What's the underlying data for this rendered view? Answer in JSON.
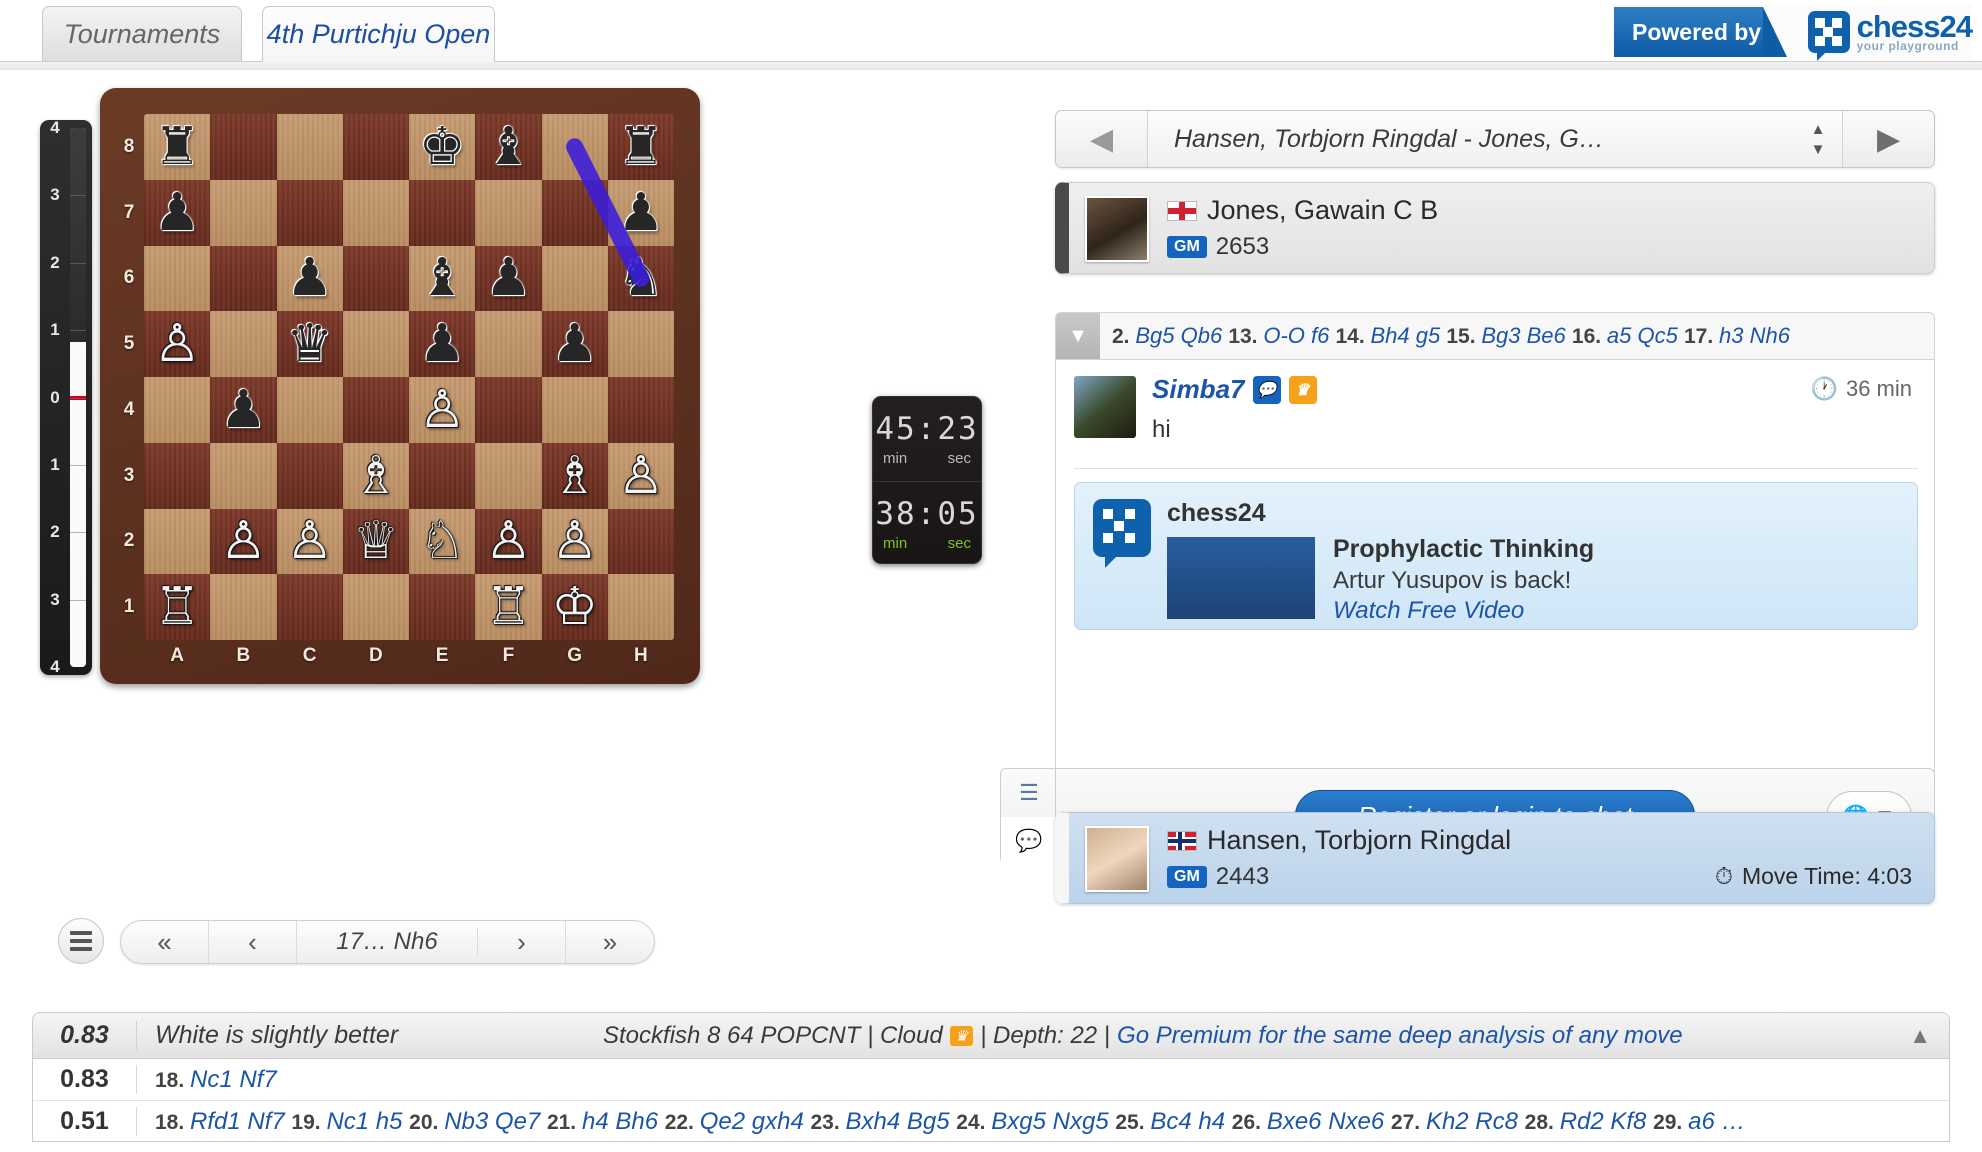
{
  "tabs": {
    "inactive": "Tournaments",
    "active": "4th Purtichju Open"
  },
  "powered": {
    "label": "Powered by",
    "brand": "chess24",
    "tagline": "your playground"
  },
  "eval_bar": {
    "ticks": [
      "4",
      "3",
      "2",
      "1",
      "0",
      "1",
      "2",
      "3",
      "4"
    ],
    "value": 0.83,
    "max": 4
  },
  "board": {
    "files": [
      "A",
      "B",
      "C",
      "D",
      "E",
      "F",
      "G",
      "H"
    ],
    "ranks": [
      "8",
      "7",
      "6",
      "5",
      "4",
      "3",
      "2",
      "1"
    ],
    "pieces": [
      {
        "sq": "a8",
        "color": "b",
        "type": "rook",
        "glyph": "♜"
      },
      {
        "sq": "e8",
        "color": "b",
        "type": "king",
        "glyph": "♚"
      },
      {
        "sq": "f8",
        "color": "b",
        "type": "bishop",
        "glyph": "♝"
      },
      {
        "sq": "h8",
        "color": "b",
        "type": "rook",
        "glyph": "♜"
      },
      {
        "sq": "a7",
        "color": "b",
        "type": "pawn",
        "glyph": "♟"
      },
      {
        "sq": "h7",
        "color": "b",
        "type": "pawn",
        "glyph": "♟"
      },
      {
        "sq": "c6",
        "color": "b",
        "type": "pawn",
        "glyph": "♟"
      },
      {
        "sq": "e6",
        "color": "b",
        "type": "bishop",
        "glyph": "♝"
      },
      {
        "sq": "f6",
        "color": "b",
        "type": "pawn",
        "glyph": "♟"
      },
      {
        "sq": "h6",
        "color": "b",
        "type": "knight",
        "glyph": "♞"
      },
      {
        "sq": "a5",
        "color": "w",
        "type": "pawn",
        "glyph": "♙"
      },
      {
        "sq": "c5",
        "color": "b",
        "type": "queen",
        "glyph": "♛"
      },
      {
        "sq": "e5",
        "color": "b",
        "type": "pawn",
        "glyph": "♟"
      },
      {
        "sq": "g5",
        "color": "b",
        "type": "pawn",
        "glyph": "♟"
      },
      {
        "sq": "b4",
        "color": "b",
        "type": "pawn",
        "glyph": "♟"
      },
      {
        "sq": "e4",
        "color": "w",
        "type": "pawn",
        "glyph": "♙"
      },
      {
        "sq": "d3",
        "color": "w",
        "type": "bishop",
        "glyph": "♗"
      },
      {
        "sq": "g3",
        "color": "w",
        "type": "bishop",
        "glyph": "♗"
      },
      {
        "sq": "h3",
        "color": "w",
        "type": "pawn",
        "glyph": "♙"
      },
      {
        "sq": "b2",
        "color": "w",
        "type": "pawn",
        "glyph": "♙"
      },
      {
        "sq": "c2",
        "color": "w",
        "type": "pawn",
        "glyph": "♙"
      },
      {
        "sq": "d2",
        "color": "w",
        "type": "queen",
        "glyph": "♕"
      },
      {
        "sq": "e2",
        "color": "w",
        "type": "knight",
        "glyph": "♘"
      },
      {
        "sq": "f2",
        "color": "w",
        "type": "pawn",
        "glyph": "♙"
      },
      {
        "sq": "g2",
        "color": "w",
        "type": "pawn",
        "glyph": "♙"
      },
      {
        "sq": "a1",
        "color": "w",
        "type": "rook",
        "glyph": "♖"
      },
      {
        "sq": "f1",
        "color": "w",
        "type": "rook",
        "glyph": "♖"
      },
      {
        "sq": "g1",
        "color": "w",
        "type": "king",
        "glyph": "♔"
      }
    ],
    "arrow": {
      "from": "g8",
      "to": "h6",
      "color": "#3b1ddb"
    }
  },
  "clocks": {
    "top": {
      "min": "45",
      "sec": "23",
      "min_label": "min",
      "sec_label": "sec",
      "active": false
    },
    "bottom": {
      "min": "38",
      "sec": "05",
      "min_label": "min",
      "sec_label": "sec",
      "active": true
    }
  },
  "board_nav": {
    "menu_icon": "hamburger-icon",
    "first": "«",
    "prev": "‹",
    "current_move": "17… Nh6",
    "next": "›",
    "last": "»"
  },
  "game_selector": {
    "prev_icon": "◀",
    "title": "Hansen, Torbjorn Ringdal - Jones, G…",
    "next_icon": "▶",
    "spinner_up": "▲",
    "spinner_down": "▼"
  },
  "players": {
    "black": {
      "name": "Jones, Gawain C B",
      "title": "GM",
      "rating": "2653",
      "country": "England"
    },
    "white": {
      "name": "Hansen, Torbjorn Ringdal",
      "title": "GM",
      "rating": "2443",
      "country": "Norway",
      "move_time": "Move Time: 4:03"
    }
  },
  "move_strip": {
    "collapse_icon": "▼",
    "tokens": [
      {
        "t": "2.",
        "k": "no"
      },
      {
        "t": "Bg5 Qb6",
        "k": "mv"
      },
      {
        "t": "13.",
        "k": "no"
      },
      {
        "t": "O-O f6",
        "k": "mv"
      },
      {
        "t": "14.",
        "k": "no"
      },
      {
        "t": "Bh4 g5",
        "k": "mv"
      },
      {
        "t": "15.",
        "k": "no"
      },
      {
        "t": "Bg3 Be6",
        "k": "mv"
      },
      {
        "t": "16.",
        "k": "no"
      },
      {
        "t": "a5 Qc5",
        "k": "mv"
      },
      {
        "t": "17.",
        "k": "no"
      },
      {
        "t": "h3 Nh6",
        "k": "mv"
      }
    ]
  },
  "chat": {
    "message": {
      "user": "Simba7",
      "text": "hi",
      "time": "36 min",
      "badges": [
        "chat-badge",
        "premium-crown-badge"
      ],
      "clock_icon": "clock-icon"
    },
    "ad": {
      "brand": "chess24",
      "title": "Prophylactic Thinking",
      "subtitle": "Artur Yusupov is back!",
      "link": "Watch Free Video"
    },
    "login_button": "Register or login to chat",
    "lang_icon": "globe-icon",
    "tabs": [
      "list-icon",
      "chat-bubbles-icon"
    ]
  },
  "analysis": {
    "header": {
      "score": "0.83",
      "verdict": "White is slightly better",
      "engine": "Stockfish 8 64 POPCNT | Cloud",
      "cloud_badge": "♛",
      "depth": "| Depth: 22 |",
      "premium_link": "Go Premium for the same deep analysis of any move",
      "collapse_icon": "▲"
    },
    "lines": [
      {
        "score": "0.83",
        "tokens": [
          {
            "t": "18.",
            "k": "no"
          },
          {
            "t": "Nc1 Nf7",
            "k": "mv"
          }
        ]
      },
      {
        "score": "0.51",
        "tokens": [
          {
            "t": "18.",
            "k": "no"
          },
          {
            "t": "Rfd1 Nf7",
            "k": "mv"
          },
          {
            "t": "19.",
            "k": "no"
          },
          {
            "t": "Nc1 h5",
            "k": "mv"
          },
          {
            "t": "20.",
            "k": "no"
          },
          {
            "t": "Nb3 Qe7",
            "k": "mv"
          },
          {
            "t": "21.",
            "k": "no"
          },
          {
            "t": "h4 Bh6",
            "k": "mv"
          },
          {
            "t": "22.",
            "k": "no"
          },
          {
            "t": "Qe2 gxh4",
            "k": "mv"
          },
          {
            "t": "23.",
            "k": "no"
          },
          {
            "t": "Bxh4 Bg5",
            "k": "mv"
          },
          {
            "t": "24.",
            "k": "no"
          },
          {
            "t": "Bxg5 Nxg5",
            "k": "mv"
          },
          {
            "t": "25.",
            "k": "no"
          },
          {
            "t": "Bc4 h4",
            "k": "mv"
          },
          {
            "t": "26.",
            "k": "no"
          },
          {
            "t": "Bxe6 Nxe6",
            "k": "mv"
          },
          {
            "t": "27.",
            "k": "no"
          },
          {
            "t": "Kh2 Rc8",
            "k": "mv"
          },
          {
            "t": "28.",
            "k": "no"
          },
          {
            "t": "Rd2 Kf8",
            "k": "mv"
          },
          {
            "t": "29.",
            "k": "no"
          },
          {
            "t": "a6 …",
            "k": "mv"
          }
        ]
      }
    ]
  },
  "colors": {
    "accent": "#1b54a8",
    "brand": "#0e62ad",
    "premium": "#f5a21a",
    "active_clock": "#7fc51c"
  }
}
